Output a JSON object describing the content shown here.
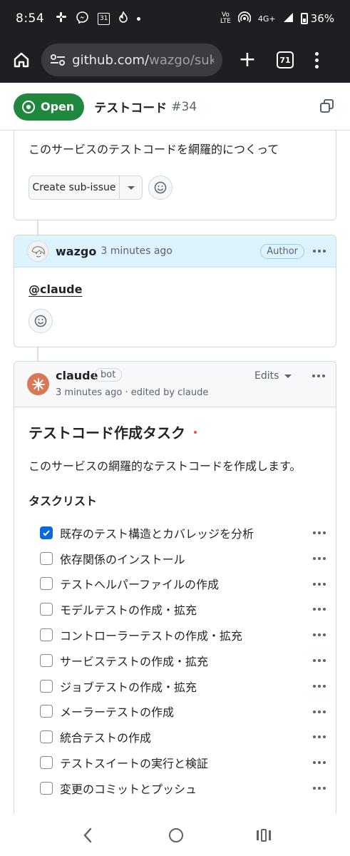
{
  "status_bar": {
    "time": "8:54",
    "left_icons": [
      "slack-icon",
      "messenger-icon",
      "calendar-icon",
      "fire-icon",
      "dot-icon"
    ],
    "calendar_day": "31",
    "volte_top": "Vo",
    "volte_bottom": "LTE",
    "network": "4G+",
    "battery": "36%"
  },
  "browser": {
    "url_domain": "github.com/",
    "url_path": "wazgo/sukky",
    "tab_count": "71"
  },
  "issue": {
    "state": "Open",
    "title": "テストコード",
    "number": "#34"
  },
  "first_comment": {
    "body": "このサービスのテストコードを網羅的につくって",
    "create_subissue_label": "Create sub-issue"
  },
  "second_comment": {
    "author": "wazgo",
    "time": "3 minutes ago",
    "badge": "Author",
    "body": "@claude"
  },
  "third_comment": {
    "author": "claude",
    "badge": "bot",
    "meta": "3 minutes ago · edited by claude",
    "edits_label": "Edits",
    "heading": "テストコード作成タスク",
    "description": "このサービスの網羅的なテストコードを作成します。",
    "list_heading": "タスクリスト",
    "tasks": [
      {
        "label": "既存のテスト構造とカバレッジを分析",
        "checked": true
      },
      {
        "label": "依存関係のインストール",
        "checked": false
      },
      {
        "label": "テストヘルパーファイルの作成",
        "checked": false
      },
      {
        "label": "モデルテストの作成・拡充",
        "checked": false
      },
      {
        "label": "コントローラーテストの作成・拡充",
        "checked": false
      },
      {
        "label": "サービステストの作成・拡充",
        "checked": false
      },
      {
        "label": "ジョブテストの作成・拡充",
        "checked": false
      },
      {
        "label": "メーラーテストの作成",
        "checked": false
      },
      {
        "label": "統合テストの作成",
        "checked": false
      },
      {
        "label": "テストスイートの実行と検証",
        "checked": false
      },
      {
        "label": "変更のコミットとプッシュ",
        "checked": false
      }
    ]
  },
  "colors": {
    "open_green": "#1f883d",
    "checkbox_blue": "#0969da",
    "author_header_bg": "#ddf4ff",
    "claude_orange": "#d97757"
  }
}
